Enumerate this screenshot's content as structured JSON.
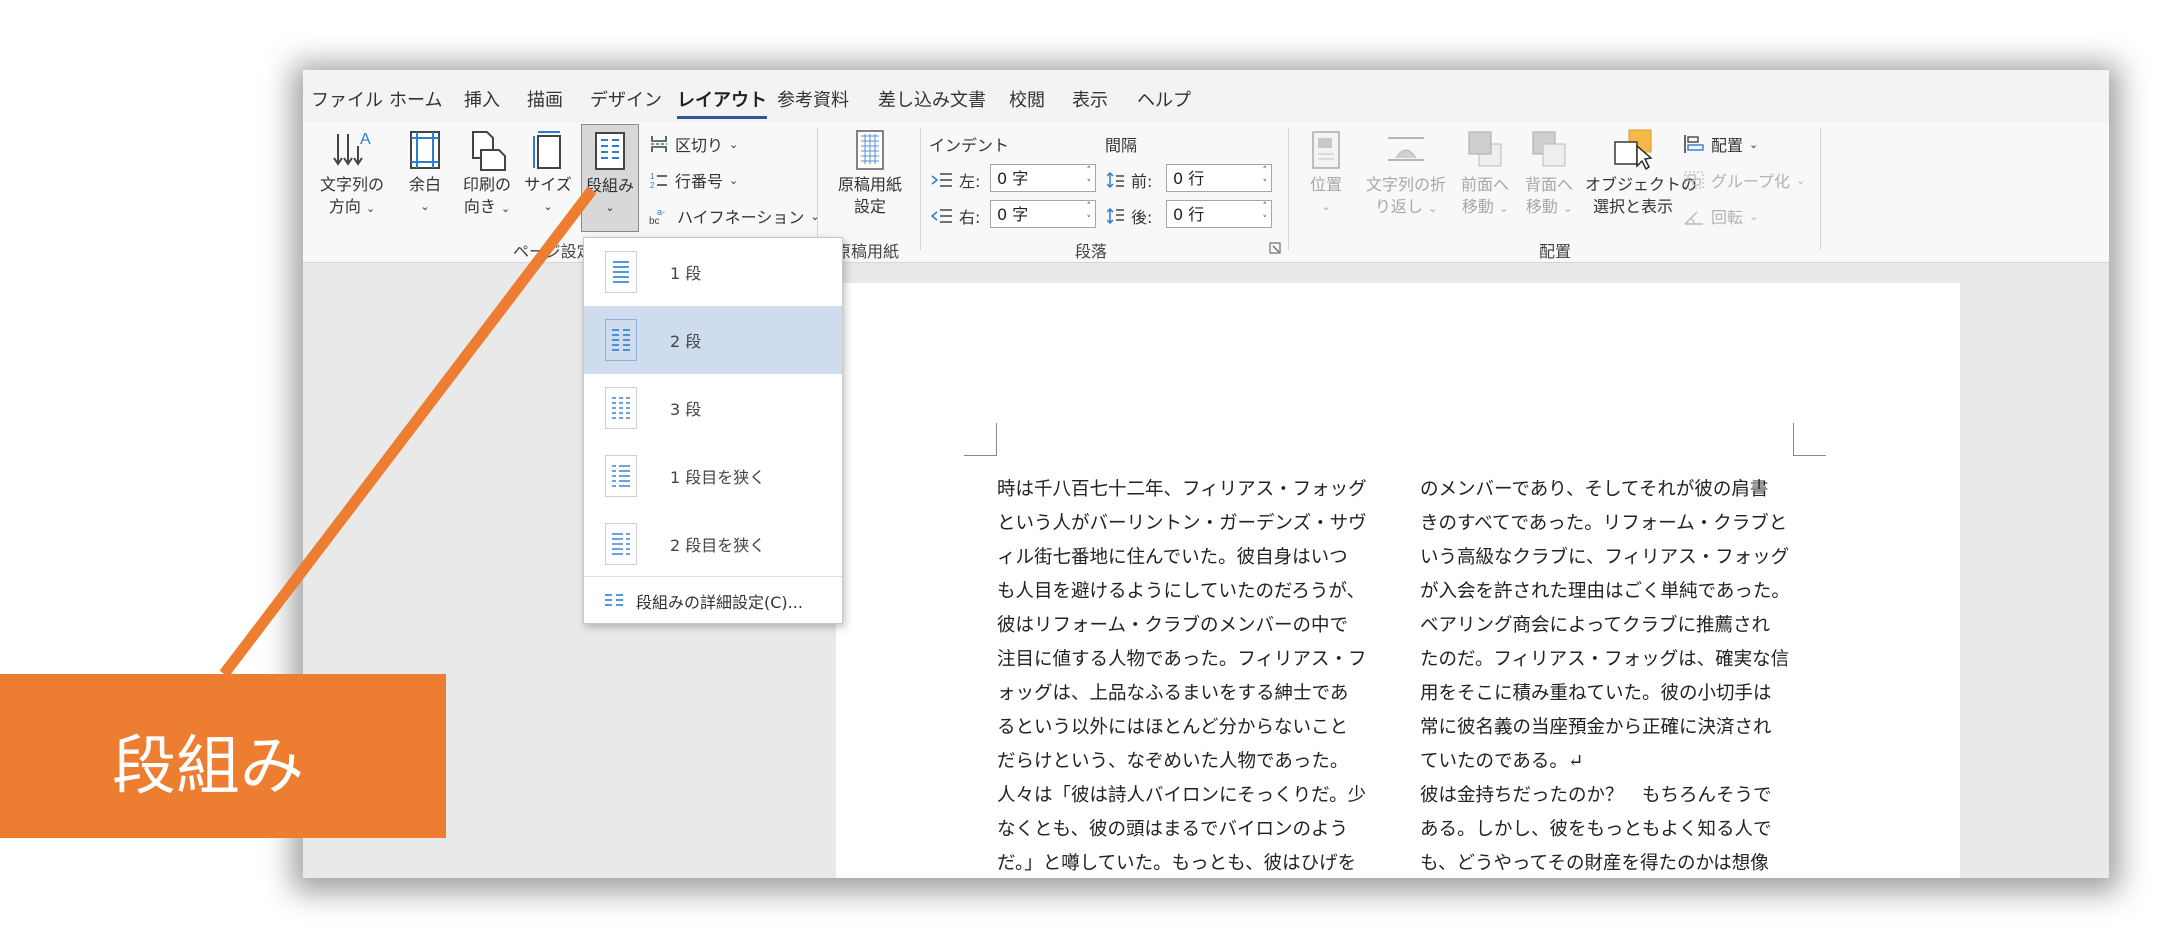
{
  "menu_tabs": [
    "ファイル",
    "ホーム",
    "挿入",
    "描画",
    "デザイン",
    "レイアウト",
    "参考資料",
    "差し込み文書",
    "校閲",
    "表示",
    "ヘルプ"
  ],
  "active_tab": "レイアウト",
  "ribbon": {
    "page_setup": {
      "text_direction": [
        "文字列の",
        "方向"
      ],
      "margins": "余白",
      "orientation": [
        "印刷の",
        "向き"
      ],
      "size": "サイズ",
      "columns": "段組み",
      "breaks": "区切り",
      "line_numbers": "行番号",
      "hyphenation": "ハイフネーション",
      "group_label": "ページ設定"
    },
    "manuscript": {
      "button": [
        "原稿用紙",
        "設定"
      ],
      "group_label": "原稿用紙"
    },
    "paragraph": {
      "indent_header": "インデント",
      "spacing_header": "間隔",
      "left_label": "左:",
      "left_value": "0 字",
      "right_label": "右:",
      "right_value": "0 字",
      "before_label": "前:",
      "before_value": "0 行",
      "after_label": "後:",
      "after_value": "0 行",
      "group_label": "段落"
    },
    "arrange": {
      "position": "位置",
      "wrap_text": [
        "文字列の折",
        "り返し"
      ],
      "bring_forward": [
        "前面へ",
        "移動"
      ],
      "send_backward": [
        "背面へ",
        "移動"
      ],
      "selection_pane": [
        "オブジェクトの",
        "選択と表示"
      ],
      "align": "配置",
      "group": "グループ化",
      "rotate": "回転",
      "group_label": "配置"
    }
  },
  "columns_dropdown": {
    "items": [
      "1 段",
      "2 段",
      "3 段",
      "1 段目を狭く",
      "2 段目を狭く"
    ],
    "selected_index": 1,
    "more": "段組みの詳細設定(C)..."
  },
  "document": {
    "left_column": [
      "時は千八百七十二年、フィリアス・フォッグ",
      "という人がバーリントン・ガーデンズ・サヴ",
      "ィル街七番地に住んでいた。彼自身はいつ",
      "も人目を避けるようにしていたのだろうが、",
      "彼はリフォーム・クラブのメンバーの中で",
      "注目に値する人物であった。フィリアス・フ",
      "ォッグは、上品なふるまいをする紳士であ",
      "るという以外にはほとんど分からないこと",
      "だらけという、なぞめいた人物であった。",
      "人々は「彼は詩人バイロンにそっくりだ。少",
      "なくとも、彼の頭はまるでバイロンのよう",
      "だ。」と噂していた。もっとも、彼はひげを"
    ],
    "right_column": [
      "のメンバーであり、そしてそれが彼の肩書",
      "きのすべてであった。リフォーム・クラブと",
      "いう高級なクラブに、フィリアス・フォッグ",
      "が入会を許された理由はごく単純であった。",
      "ベアリング商会によってクラブに推薦され",
      "たのだ。フィリアス・フォッグは、確実な信",
      "用をそこに積み重ねていた。彼の小切手は",
      "常に彼名義の当座預金から正確に決済され",
      "ていたのである。↵",
      "彼は金持ちだったのか？　もちろんそうで",
      "ある。しかし、彼をもっともよく知る人で",
      "も、どうやってその財産を得たのかは想像"
    ]
  },
  "callout": {
    "text": "段組み",
    "color": "#ed7d31"
  }
}
